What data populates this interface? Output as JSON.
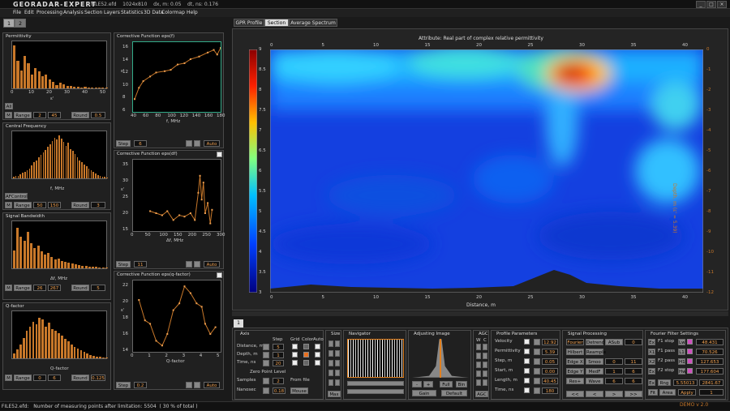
{
  "app": {
    "logo": "GEORADAR-EXPERT",
    "file": "FILE52.efd",
    "size": "1024x810",
    "dx": "dx, m: 0.05",
    "dt": "dt, ns: 0.176",
    "demo": "DEMO v 2.0"
  },
  "menu": [
    "File",
    "Edit",
    "Processing",
    "Analysis",
    "Section",
    "Layers",
    "Statistics",
    "3D Data",
    "Colormap",
    "Help"
  ],
  "left_tabs": [
    "1",
    "2"
  ],
  "hist": [
    {
      "title": "Permittivity",
      "axis": "ε'",
      "ticks": [
        "0",
        "10",
        "20",
        "30",
        "40",
        "50"
      ],
      "all": "All",
      "m": "M",
      "range": "Range",
      "v1": "2",
      "v2": "45",
      "round": "Round",
      "rv": "0.5",
      "values": [
        95,
        60,
        40,
        72,
        55,
        30,
        45,
        38,
        26,
        30,
        20,
        14,
        8,
        12,
        9,
        6,
        5,
        3,
        4,
        2,
        3,
        2,
        1,
        1,
        2,
        1,
        1
      ]
    },
    {
      "title": "Central Frequency",
      "axis": "f, MHz",
      "ctl": "AFControl",
      "m": "M",
      "range": "Range",
      "v1": "50",
      "v2": "150",
      "round": "Round",
      "rv": "3",
      "values": [
        3,
        5,
        6,
        9,
        12,
        14,
        18,
        22,
        28,
        35,
        40,
        46,
        52,
        58,
        62,
        70,
        75,
        82,
        90,
        86,
        95,
        88,
        80,
        72,
        78,
        65,
        60,
        54,
        46,
        40,
        35,
        30,
        26,
        22,
        18,
        14,
        10,
        8,
        6,
        4,
        3,
        2
      ]
    },
    {
      "title": "Signal Bandwidth",
      "axis": "Δf, MHz",
      "m": "M",
      "range": "Range",
      "v1": "26",
      "v2": "267",
      "round": "Round",
      "rv": "5",
      "values": [
        40,
        90,
        70,
        60,
        80,
        55,
        45,
        50,
        38,
        30,
        34,
        25,
        20,
        22,
        16,
        14,
        12,
        10,
        9,
        8,
        6,
        5,
        4,
        3,
        3,
        2,
        2,
        1
      ]
    },
    {
      "title": "Q-factor",
      "axis": "Q-factor",
      "m": "M",
      "range": "Range",
      "v1": "0",
      "v2": "6",
      "round": "Round",
      "rv": "0.125",
      "values": [
        10,
        20,
        30,
        45,
        60,
        70,
        80,
        75,
        90,
        85,
        70,
        78,
        65,
        60,
        55,
        50,
        42,
        38,
        30,
        25,
        22,
        18,
        14,
        10,
        8,
        6,
        4,
        3,
        2,
        1
      ]
    }
  ],
  "corr": [
    {
      "title": "Corrective Function eps(f)",
      "axis": "f, MHz",
      "ylabel": "ε'",
      "xt": [
        "40",
        "60",
        "80",
        "100",
        "120",
        "140",
        "160",
        "180"
      ],
      "yt": [
        "6",
        "8",
        "10",
        "12",
        "14",
        "16"
      ],
      "step": "Step",
      "sv": "6",
      "mode": "Auto",
      "points": [
        [
          0,
          0.82
        ],
        [
          0.05,
          0.65
        ],
        [
          0.1,
          0.55
        ],
        [
          0.18,
          0.48
        ],
        [
          0.25,
          0.42
        ],
        [
          0.35,
          0.4
        ],
        [
          0.42,
          0.38
        ],
        [
          0.5,
          0.3
        ],
        [
          0.58,
          0.28
        ],
        [
          0.65,
          0.22
        ],
        [
          0.75,
          0.18
        ],
        [
          0.85,
          0.12
        ],
        [
          0.92,
          0.08
        ],
        [
          0.96,
          0.15
        ],
        [
          1,
          0.05
        ]
      ]
    },
    {
      "title": "Corrective Function eps(df)",
      "axis": "Δf, MHz",
      "ylabel": "ε'",
      "xt": [
        "0",
        "50",
        "100",
        "150",
        "200",
        "250",
        "300"
      ],
      "yt": [
        "15",
        "20",
        "25",
        "30",
        "35"
      ],
      "step": "Step",
      "sv": "11",
      "mode": "Auto",
      "points": [
        [
          0.18,
          0.72
        ],
        [
          0.25,
          0.75
        ],
        [
          0.32,
          0.78
        ],
        [
          0.38,
          0.72
        ],
        [
          0.45,
          0.85
        ],
        [
          0.52,
          0.78
        ],
        [
          0.58,
          0.8
        ],
        [
          0.65,
          0.75
        ],
        [
          0.7,
          0.85
        ],
        [
          0.74,
          0.45
        ],
        [
          0.76,
          0.2
        ],
        [
          0.78,
          0.55
        ],
        [
          0.8,
          0.3
        ],
        [
          0.82,
          0.75
        ],
        [
          0.85,
          0.6
        ],
        [
          0.88,
          0.9
        ],
        [
          0.9,
          0.7
        ]
      ]
    },
    {
      "title": "Corrective Function eps(q-factor)",
      "axis": "Q-factor",
      "ylabel": "ε'",
      "xt": [
        "0",
        "1",
        "2",
        "3",
        "4",
        "5"
      ],
      "yt": [
        "14",
        "16",
        "18",
        "20",
        "22"
      ],
      "step": "Step",
      "sv": "0.2",
      "mode": "Auto",
      "points": [
        [
          0.05,
          0.25
        ],
        [
          0.12,
          0.55
        ],
        [
          0.18,
          0.6
        ],
        [
          0.25,
          0.85
        ],
        [
          0.32,
          0.92
        ],
        [
          0.38,
          0.75
        ],
        [
          0.45,
          0.4
        ],
        [
          0.52,
          0.3
        ],
        [
          0.58,
          0.05
        ],
        [
          0.65,
          0.15
        ],
        [
          0.72,
          0.3
        ],
        [
          0.78,
          0.35
        ],
        [
          0.82,
          0.6
        ],
        [
          0.88,
          0.75
        ],
        [
          0.94,
          0.65
        ]
      ]
    }
  ],
  "right_tabs": [
    "GPR Profile",
    "Section",
    "Average Spectrum"
  ],
  "section": {
    "title": "Attribute:  Real part of complex relative permittivity",
    "xlabel": "Distance, m",
    "ylabel": "Depth, m (ε' = 5.39)",
    "top_ticks": [
      "0",
      "5",
      "10",
      "15",
      "20",
      "25",
      "30",
      "35",
      "40"
    ],
    "bottom_ticks": [
      "0",
      "5",
      "10",
      "15",
      "20",
      "25",
      "30",
      "35",
      "40"
    ],
    "left_ticks": [
      "9",
      "8.5",
      "8",
      "7.5",
      "7",
      "6.5",
      "6",
      "5.5",
      "5",
      "4.5",
      "4",
      "3.5",
      "3"
    ],
    "right_ticks": [
      "0",
      "-1",
      "-2",
      "-3",
      "-4",
      "-5",
      "-6",
      "-7",
      "-8",
      "-9",
      "-10",
      "-11",
      "-12"
    ]
  },
  "bottom_tab": "1",
  "axis_panel": {
    "title": "Axis",
    "step": "Step",
    "grid": "Grid",
    "color": "Color",
    "auto": "Auto",
    "rows": [
      {
        "label": "Distance, m",
        "sv": "5"
      },
      {
        "label": "Depth, m",
        "sv": "1"
      },
      {
        "label": "Time, ns",
        "sv": "20"
      }
    ],
    "zero": "Zero Point Level",
    "samples": "Samples",
    "sv2": "2",
    "fromfile": "From file",
    "nanosec": "Nanosec",
    "nv": "0.18",
    "mouse": "Mouse"
  },
  "size": {
    "title": "Size",
    "max": "Max"
  },
  "navigator": {
    "title": "Navigator"
  },
  "adjust": {
    "title": "Adjusting Image",
    "gain": "Gain",
    "default": "Default",
    "full": "Full",
    "bin": "Bin",
    "minus": "-",
    "plus": "+"
  },
  "agc": {
    "title": "AGC",
    "agc": "AGC",
    "w": "W",
    "c": "C"
  },
  "params": {
    "title": "Profile Parameters",
    "rows": [
      {
        "l": "Velocity",
        "v": "12.92"
      },
      {
        "l": "Permittivity",
        "v": "5.39"
      },
      {
        "l": "Step, m",
        "v": "0.05"
      },
      {
        "l": "Start, m",
        "v": "0.00"
      },
      {
        "l": "Length, m",
        "v": "40.45"
      },
      {
        "l": "Time, ns",
        "v": "180"
      }
    ]
  },
  "sigproc": {
    "title": "Signal Processing",
    "rows": [
      [
        "Fourier",
        "Detrend",
        "ASub",
        "0"
      ],
      [
        "Hilbert",
        "Reample",
        "",
        ""
      ],
      [
        "Edge X",
        "Smoo",
        "0",
        "11"
      ],
      [
        "Edge Y",
        "MedF",
        "1",
        "6"
      ],
      [
        "Res+",
        "Wave",
        "6",
        "6"
      ]
    ],
    "nav": [
      "<<",
      "<",
      ">",
      ">>"
    ]
  },
  "fourier": {
    "title": "Fourier Filter Settings",
    "rows": [
      {
        "a": "Ex",
        "l": "F1 stop",
        "b": "Lw",
        "v": "48.431"
      },
      {
        "a": "X1",
        "l": "F1 pass",
        "b": "L1",
        "v": "70.526"
      },
      {
        "a": "X2",
        "l": "F2 pass",
        "b": "H1",
        "v": "127.653"
      },
      {
        "a": "Ex",
        "l": "F2 stop",
        "b": "Hw",
        "v": "177.604"
      }
    ],
    "rng": "Rng",
    "rv": "5.55013",
    "rv2": "2841.67",
    "fit": "Fit",
    "area": "Area",
    "apply": "Apply",
    "av": "1"
  },
  "status": {
    "file": "FILE52.efd:",
    "msg": "Number of measuring points after limitation: 5504  ( 30 % of total )"
  },
  "colors": {
    "accent": "#c8782a",
    "value": "#f0a050"
  }
}
